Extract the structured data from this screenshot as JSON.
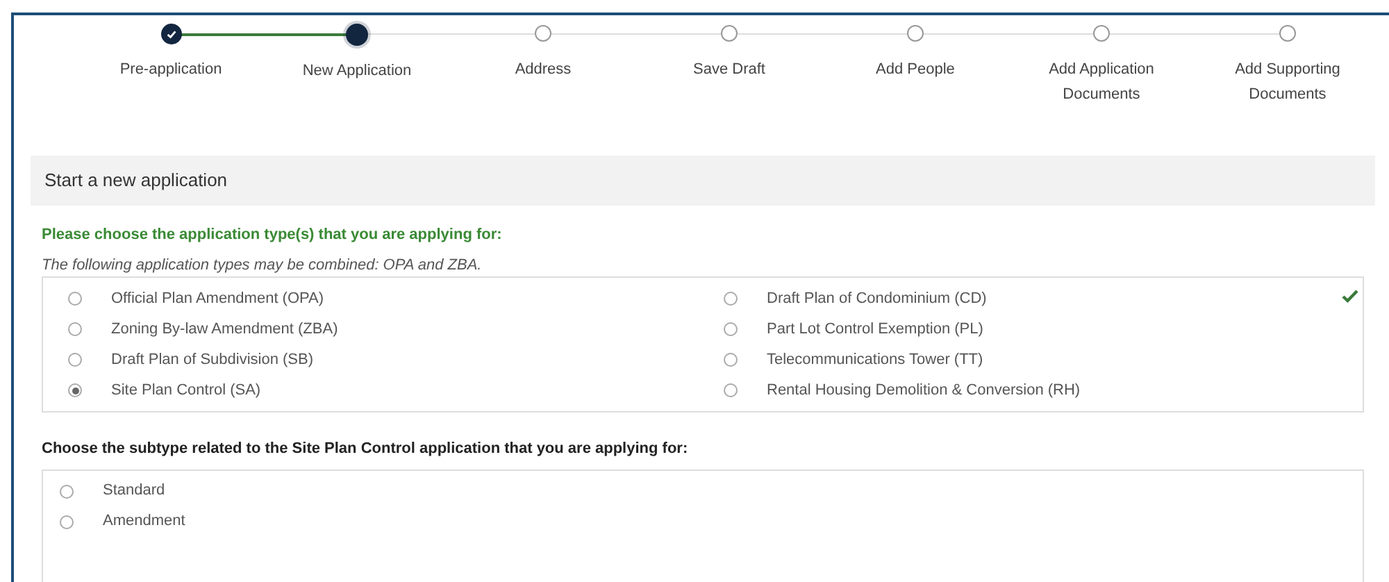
{
  "steps": [
    {
      "label": "Pre-application",
      "completed": true,
      "current": false
    },
    {
      "label": "New Application",
      "completed": false,
      "current": true
    },
    {
      "label": "Address",
      "completed": false,
      "current": false
    },
    {
      "label": "Save Draft",
      "completed": false,
      "current": false
    },
    {
      "label": "Add People",
      "completed": false,
      "current": false
    },
    {
      "label": "Add Application Documents",
      "completed": false,
      "current": false
    },
    {
      "label": "Add Supporting Documents",
      "completed": false,
      "current": false
    }
  ],
  "section_title": "Start a new application",
  "type_question": "Please choose the application type(s) that you are applying for:",
  "type_hint": "The following application types may be combined: OPA and ZBA.",
  "type_valid": true,
  "application_types": [
    {
      "label": "Official Plan Amendment (OPA)",
      "selected": false
    },
    {
      "label": "Zoning By-law Amendment (ZBA)",
      "selected": false
    },
    {
      "label": "Draft Plan of Subdivision (SB)",
      "selected": false
    },
    {
      "label": "Site Plan Control (SA)",
      "selected": true
    },
    {
      "label": "Draft Plan of Condominium (CD)",
      "selected": false
    },
    {
      "label": "Part Lot Control Exemption (PL)",
      "selected": false
    },
    {
      "label": "Telecommunications Tower (TT)",
      "selected": false
    },
    {
      "label": "Rental Housing Demolition & Conversion (RH)",
      "selected": false
    }
  ],
  "subtype_question": "Choose the subtype related to the Site Plan Control application that you are applying for:",
  "subtypes": [
    {
      "label": "Standard",
      "selected": false
    },
    {
      "label": "Amendment",
      "selected": false
    }
  ]
}
